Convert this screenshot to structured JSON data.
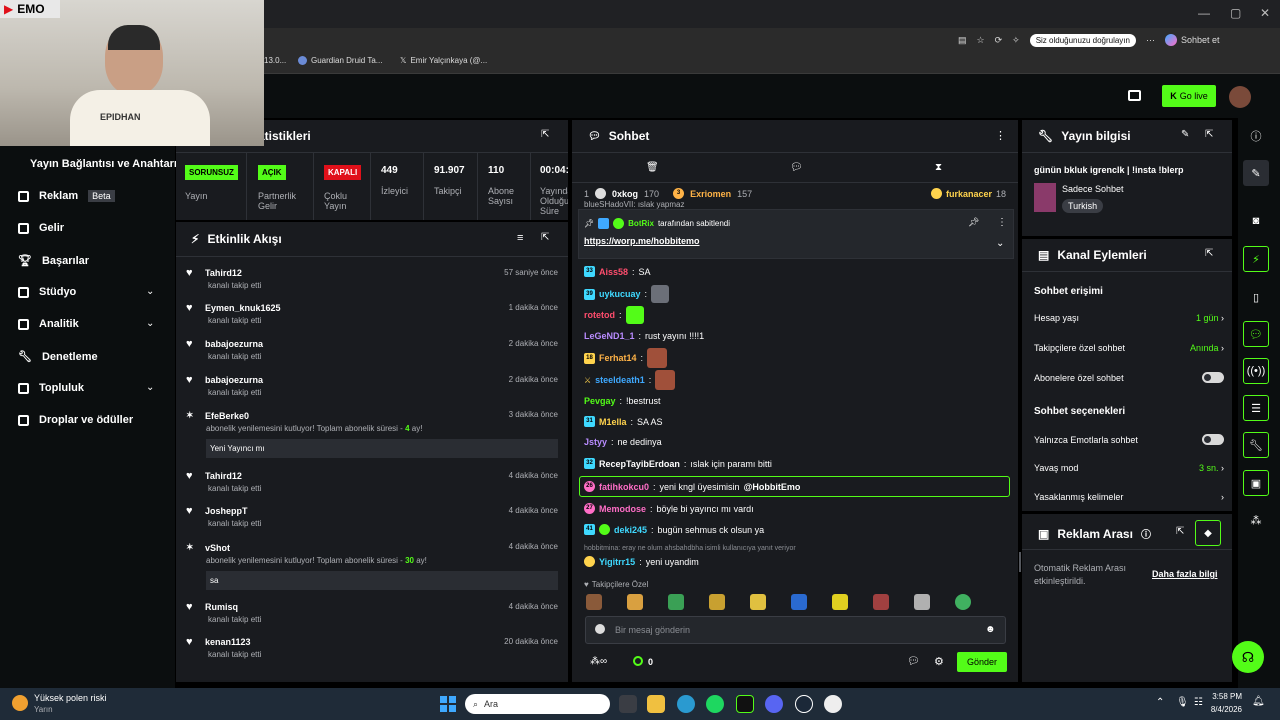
{
  "browser": {
    "bookmarks": [
      "13.0...",
      "Guardian Druid Ta...",
      "Emir Yalçınkaya (@..."
    ],
    "profile_pill": "Siz olduğunuzu doğrulayın",
    "copilot": "Sohbet et",
    "more": "···"
  },
  "webcam": {
    "overlay_text": "EMO",
    "shirt_text": "EPIDHAN"
  },
  "header": {
    "go_live": "Go live"
  },
  "sidebar": {
    "items": [
      {
        "label": "Yayın Bağlantısı ve Anahtarı"
      },
      {
        "label": "Reklam",
        "badge": "Beta"
      },
      {
        "label": "Gelir"
      },
      {
        "label": "Başarılar"
      },
      {
        "label": "Stüdyo"
      },
      {
        "label": "Analitik"
      },
      {
        "label": "Denetleme"
      },
      {
        "label": "Topluluk"
      },
      {
        "label": "Droplar ve ödüller"
      }
    ]
  },
  "stats": {
    "title_fragment": "atistikleri",
    "columns": [
      {
        "badge": "SORUNSUZ",
        "label": "Yayın"
      },
      {
        "badge": "AÇIK",
        "label": "Partnerlik Gelir"
      },
      {
        "badge": "KAPALI",
        "label": "Çoklu Yayın"
      },
      {
        "value": "449",
        "label": "İzleyici"
      },
      {
        "value": "91.907",
        "label": "Takipçi"
      },
      {
        "value": "110",
        "label": "Abone Sayısı"
      },
      {
        "value": "00:04:",
        "label": "Yayında Olduğu Süre"
      }
    ],
    "colors": {
      "ok": "#53fc18",
      "off": "#e0101a"
    }
  },
  "activity": {
    "title": "Etkinlik Akışı",
    "events": [
      {
        "name": "Tahird12",
        "sub": "kanalı takip etti",
        "time": "57 saniye önce"
      },
      {
        "name": "Eymen_knuk1625",
        "sub": "kanalı takip etti",
        "time": "1 dakika önce"
      },
      {
        "name": "babajoezurna",
        "sub": "kanalı takip etti",
        "time": "2 dakika önce"
      },
      {
        "name": "babajoezurna",
        "sub": "kanalı takip etti",
        "time": "2 dakika önce"
      },
      {
        "name": "EfeBerke0",
        "sub_a": "abonelik yenilemesini kutluyor! Toplam abonelik süresi - ",
        "months": "4",
        "sub_b": " ay!",
        "message": "Yeni Yayıncı mı",
        "time": "3 dakika önce"
      },
      {
        "name": "Tahird12",
        "sub": "kanalı takip etti",
        "time": "4 dakika önce"
      },
      {
        "name": "JosheppT",
        "sub": "kanalı takip etti",
        "time": "4 dakika önce"
      },
      {
        "name": "vShot",
        "sub_a": "abonelik yenilemesini kutluyor! Toplam abonelik süresi - ",
        "months": "30",
        "sub_b": " ay!",
        "message": "sa",
        "time": "4 dakika önce"
      },
      {
        "name": "Rumisq",
        "sub": "kanalı takip etti",
        "time": "4 dakika önce"
      },
      {
        "name": "kenan1123",
        "sub": "kanalı takip etti",
        "time": "20 dakika önce"
      }
    ]
  },
  "chat": {
    "title": "Sohbet",
    "top_gifters": [
      {
        "rank": "1",
        "name": "0xkog",
        "count": "170"
      },
      {
        "rank": "3",
        "name": "Exriomen",
        "count": "157"
      },
      {
        "name": "furkanacer",
        "count": "18"
      }
    ],
    "pinned": {
      "by": "BotRix",
      "by_suffix": "tarafından sabitlendi",
      "link": "https://worp.me/hobbitemo"
    },
    "cut_line": "blueSHadoVII: ıslak yapmaz",
    "messages": [
      {
        "badge": "33",
        "badge_color": "#3fd9ff",
        "user": "Aiss58",
        "color": "#ff4d6d",
        "text": "SA"
      },
      {
        "badge": "39",
        "badge_color": "#3fd9ff",
        "user": "uykucuay",
        "color": "#3fd9ff",
        "text": "",
        "emote": "#6b6f78"
      },
      {
        "user": "rotetod",
        "color": "#ff4d6d",
        "text": "",
        "emote": "#53fc18"
      },
      {
        "user": "LeGeND1_1",
        "color": "#b98cff",
        "text": "rust yayını !!!!1"
      },
      {
        "badge": "18",
        "badge_color": "#ffd34d",
        "user": "Ferhat14",
        "color": "#ffb347",
        "text": "",
        "emote": "#a0503a"
      },
      {
        "user": "steeldeath1",
        "color": "#3fa9ff",
        "text": "",
        "emote": "#a0503a"
      },
      {
        "user": "Pevgay",
        "color": "#53fc18",
        "text": "!bestrust"
      },
      {
        "badge": "31",
        "badge_color": "#3fd9ff",
        "user": "M1ella",
        "color": "#ffd34d",
        "text": "SA AS"
      },
      {
        "user": "Jstyy",
        "color": "#b98cff",
        "text": "ne dedinya"
      },
      {
        "badge": "32",
        "badge_color": "#3fd9ff",
        "user": "RecepTayibErdoan",
        "color": "#ffffff",
        "text": "ıslak için paramı bitti"
      },
      {
        "badge": "26",
        "badge_color": "#ff6ec7",
        "user": "fatihkokcu0",
        "color": "#ff6ec7",
        "text": "yeni kngl üyesimisin ",
        "mention": "@HobbitEmo",
        "highlight": true
      },
      {
        "badge": "27",
        "badge_color": "#ff6ec7",
        "user": "Memodose",
        "color": "#ff6ec7",
        "text": "böyle bi yayıncı mı vardı"
      },
      {
        "badge": "41",
        "badge_color": "#3fd9ff",
        "user": "deki245",
        "color": "#3fd9ff",
        "text": "bugün sehmus ck olsun ya"
      }
    ],
    "reply_context": "hobbitmina: eray ne olum ahsbahdbha isimli kullanıcıya yanıt veriyor",
    "last": {
      "user": "Yigitrr15",
      "color": "#3fd9ff",
      "text": "yeni uyandim"
    },
    "followers_only_label": "Takipçilere Özel",
    "input_placeholder": "Bir mesaj gönderin",
    "points": "0",
    "send": "Gönder"
  },
  "stream_info": {
    "title": "Yayın bilgisi",
    "stream_title": "günün bkluk igrencIk | !insta !blerp",
    "category": "Sadece Sohbet",
    "tag": "Turkish"
  },
  "channel_actions": {
    "title": "Kanal Eylemleri",
    "section1": "Sohbet erişimi",
    "rows1": [
      {
        "label": "Hesap yaşı",
        "value": "1 gün"
      },
      {
        "label": "Takipçilere özel sohbet",
        "value": "Anında"
      },
      {
        "label": "Abonelere özel sohbet",
        "toggle": true
      }
    ],
    "section2": "Sohbet seçenekleri",
    "rows2": [
      {
        "label": "Yalnızca Emotlarla sohbet",
        "toggle": true
      },
      {
        "label": "Yavaş mod",
        "value": "3 sn."
      },
      {
        "label": "Yasaklanmış kelimeler",
        "value": ""
      }
    ]
  },
  "ad_break": {
    "title": "Reklam Arası",
    "desc": "Otomatik Reklam Arası etkinleştirildi.",
    "link": "Daha fazla bilgi"
  },
  "taskbar": {
    "weather_title": "Yüksek polen riski",
    "weather_sub": "Yarın",
    "search": "Ara",
    "time": "3:58 PM",
    "date": "8/4/2026"
  }
}
